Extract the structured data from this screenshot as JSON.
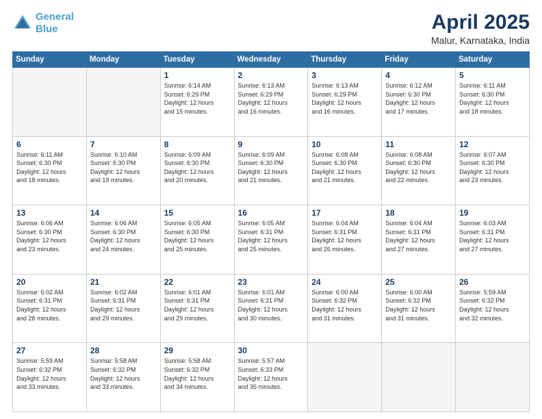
{
  "header": {
    "logo_line1": "General",
    "logo_line2": "Blue",
    "title": "April 2025",
    "subtitle": "Malur, Karnataka, India"
  },
  "calendar": {
    "days_of_week": [
      "Sunday",
      "Monday",
      "Tuesday",
      "Wednesday",
      "Thursday",
      "Friday",
      "Saturday"
    ],
    "weeks": [
      [
        {
          "day": "",
          "info": ""
        },
        {
          "day": "",
          "info": ""
        },
        {
          "day": "1",
          "info": "Sunrise: 6:14 AM\nSunset: 6:29 PM\nDaylight: 12 hours\nand 15 minutes."
        },
        {
          "day": "2",
          "info": "Sunrise: 6:13 AM\nSunset: 6:29 PM\nDaylight: 12 hours\nand 16 minutes."
        },
        {
          "day": "3",
          "info": "Sunrise: 6:13 AM\nSunset: 6:29 PM\nDaylight: 12 hours\nand 16 minutes."
        },
        {
          "day": "4",
          "info": "Sunrise: 6:12 AM\nSunset: 6:30 PM\nDaylight: 12 hours\nand 17 minutes."
        },
        {
          "day": "5",
          "info": "Sunrise: 6:11 AM\nSunset: 6:30 PM\nDaylight: 12 hours\nand 18 minutes."
        }
      ],
      [
        {
          "day": "6",
          "info": "Sunrise: 6:11 AM\nSunset: 6:30 PM\nDaylight: 12 hours\nand 18 minutes."
        },
        {
          "day": "7",
          "info": "Sunrise: 6:10 AM\nSunset: 6:30 PM\nDaylight: 12 hours\nand 19 minutes."
        },
        {
          "day": "8",
          "info": "Sunrise: 6:09 AM\nSunset: 6:30 PM\nDaylight: 12 hours\nand 20 minutes."
        },
        {
          "day": "9",
          "info": "Sunrise: 6:09 AM\nSunset: 6:30 PM\nDaylight: 12 hours\nand 21 minutes."
        },
        {
          "day": "10",
          "info": "Sunrise: 6:08 AM\nSunset: 6:30 PM\nDaylight: 12 hours\nand 21 minutes."
        },
        {
          "day": "11",
          "info": "Sunrise: 6:08 AM\nSunset: 6:30 PM\nDaylight: 12 hours\nand 22 minutes."
        },
        {
          "day": "12",
          "info": "Sunrise: 6:07 AM\nSunset: 6:30 PM\nDaylight: 12 hours\nand 23 minutes."
        }
      ],
      [
        {
          "day": "13",
          "info": "Sunrise: 6:06 AM\nSunset: 6:30 PM\nDaylight: 12 hours\nand 23 minutes."
        },
        {
          "day": "14",
          "info": "Sunrise: 6:06 AM\nSunset: 6:30 PM\nDaylight: 12 hours\nand 24 minutes."
        },
        {
          "day": "15",
          "info": "Sunrise: 6:05 AM\nSunset: 6:30 PM\nDaylight: 12 hours\nand 25 minutes."
        },
        {
          "day": "16",
          "info": "Sunrise: 6:05 AM\nSunset: 6:31 PM\nDaylight: 12 hours\nand 25 minutes."
        },
        {
          "day": "17",
          "info": "Sunrise: 6:04 AM\nSunset: 6:31 PM\nDaylight: 12 hours\nand 26 minutes."
        },
        {
          "day": "18",
          "info": "Sunrise: 6:04 AM\nSunset: 6:31 PM\nDaylight: 12 hours\nand 27 minutes."
        },
        {
          "day": "19",
          "info": "Sunrise: 6:03 AM\nSunset: 6:31 PM\nDaylight: 12 hours\nand 27 minutes."
        }
      ],
      [
        {
          "day": "20",
          "info": "Sunrise: 6:02 AM\nSunset: 6:31 PM\nDaylight: 12 hours\nand 28 minutes."
        },
        {
          "day": "21",
          "info": "Sunrise: 6:02 AM\nSunset: 6:31 PM\nDaylight: 12 hours\nand 29 minutes."
        },
        {
          "day": "22",
          "info": "Sunrise: 6:01 AM\nSunset: 6:31 PM\nDaylight: 12 hours\nand 29 minutes."
        },
        {
          "day": "23",
          "info": "Sunrise: 6:01 AM\nSunset: 6:31 PM\nDaylight: 12 hours\nand 30 minutes."
        },
        {
          "day": "24",
          "info": "Sunrise: 6:00 AM\nSunset: 6:32 PM\nDaylight: 12 hours\nand 31 minutes."
        },
        {
          "day": "25",
          "info": "Sunrise: 6:00 AM\nSunset: 6:32 PM\nDaylight: 12 hours\nand 31 minutes."
        },
        {
          "day": "26",
          "info": "Sunrise: 5:59 AM\nSunset: 6:32 PM\nDaylight: 12 hours\nand 32 minutes."
        }
      ],
      [
        {
          "day": "27",
          "info": "Sunrise: 5:59 AM\nSunset: 6:32 PM\nDaylight: 12 hours\nand 33 minutes."
        },
        {
          "day": "28",
          "info": "Sunrise: 5:58 AM\nSunset: 6:32 PM\nDaylight: 12 hours\nand 33 minutes."
        },
        {
          "day": "29",
          "info": "Sunrise: 5:58 AM\nSunset: 6:32 PM\nDaylight: 12 hours\nand 34 minutes."
        },
        {
          "day": "30",
          "info": "Sunrise: 5:57 AM\nSunset: 6:33 PM\nDaylight: 12 hours\nand 35 minutes."
        },
        {
          "day": "",
          "info": ""
        },
        {
          "day": "",
          "info": ""
        },
        {
          "day": "",
          "info": ""
        }
      ]
    ]
  }
}
